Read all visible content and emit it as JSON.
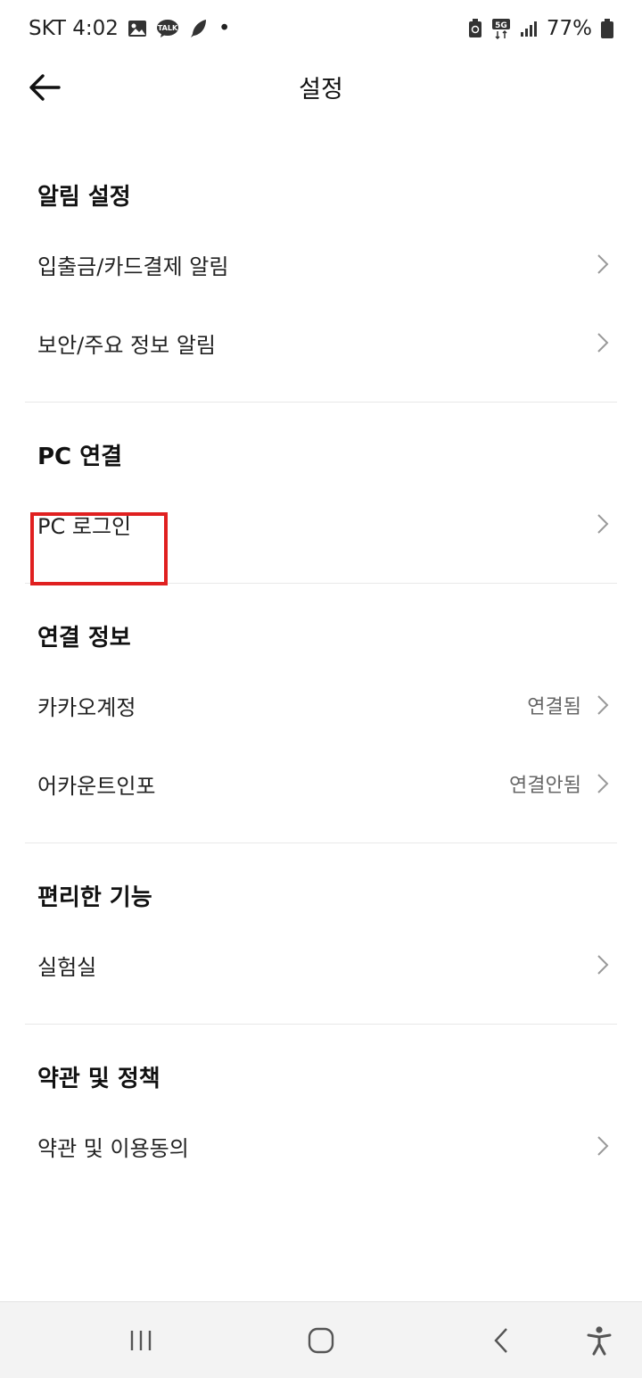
{
  "status": {
    "carrier_time": "SKT 4:02",
    "dot": "•",
    "battery": "77%",
    "icons": [
      "gallery-icon",
      "kakaotalk-icon",
      "feather-icon",
      "battery-saver-icon",
      "5g-icon",
      "signal-icon",
      "battery-icon"
    ]
  },
  "header": {
    "title": "설정",
    "back_icon": "arrow-left-icon"
  },
  "sections": [
    {
      "title": "알림 설정",
      "items": [
        {
          "label": "입출금/카드결제 알림",
          "value": ""
        },
        {
          "label": "보안/주요 정보 알림",
          "value": ""
        }
      ]
    },
    {
      "title": "PC 연결",
      "items": [
        {
          "label": "PC 로그인",
          "value": ""
        }
      ]
    },
    {
      "title": "연결 정보",
      "items": [
        {
          "label": "카카오계정",
          "value": "연결됨"
        },
        {
          "label": "어카운트인포",
          "value": "연결안됨"
        }
      ]
    },
    {
      "title": "편리한 기능",
      "items": [
        {
          "label": "실험실",
          "value": ""
        }
      ]
    },
    {
      "title": "약관 및 정책",
      "items": [
        {
          "label": "약관 및 이용동의",
          "value": ""
        }
      ]
    }
  ],
  "highlight_color": "#e02020",
  "navigation": {
    "icons": [
      "recent-apps-icon",
      "home-icon",
      "back-icon",
      "accessibility-icon"
    ]
  }
}
